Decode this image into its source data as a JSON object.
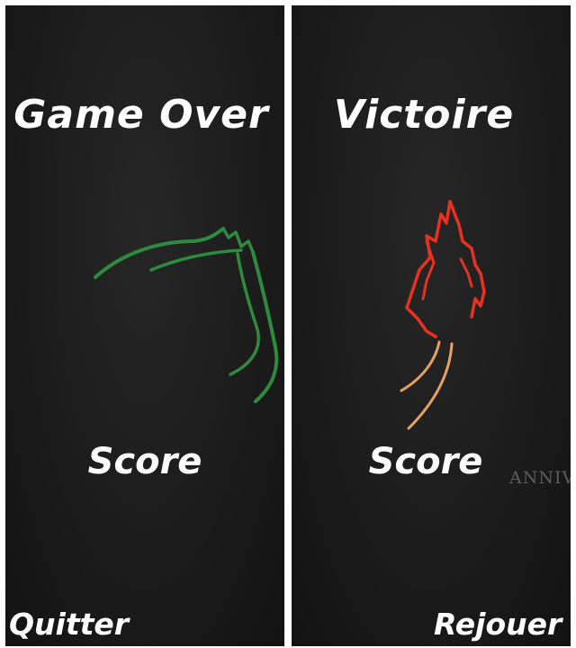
{
  "left_panel": {
    "title": "Game Over",
    "score_label": "Score",
    "button_label": "Quitter",
    "art_color": "#2e8b3e"
  },
  "right_panel": {
    "title": "Victoire",
    "score_label": "Score",
    "watermark": "ANNIV",
    "button_label": "Rejouer",
    "flame_color": "#e8321f",
    "trail_color": "#e8a060"
  },
  "colors": {
    "panel_bg": "#1c1c1c",
    "divider": "#ffffff",
    "text": "#ffffff"
  }
}
